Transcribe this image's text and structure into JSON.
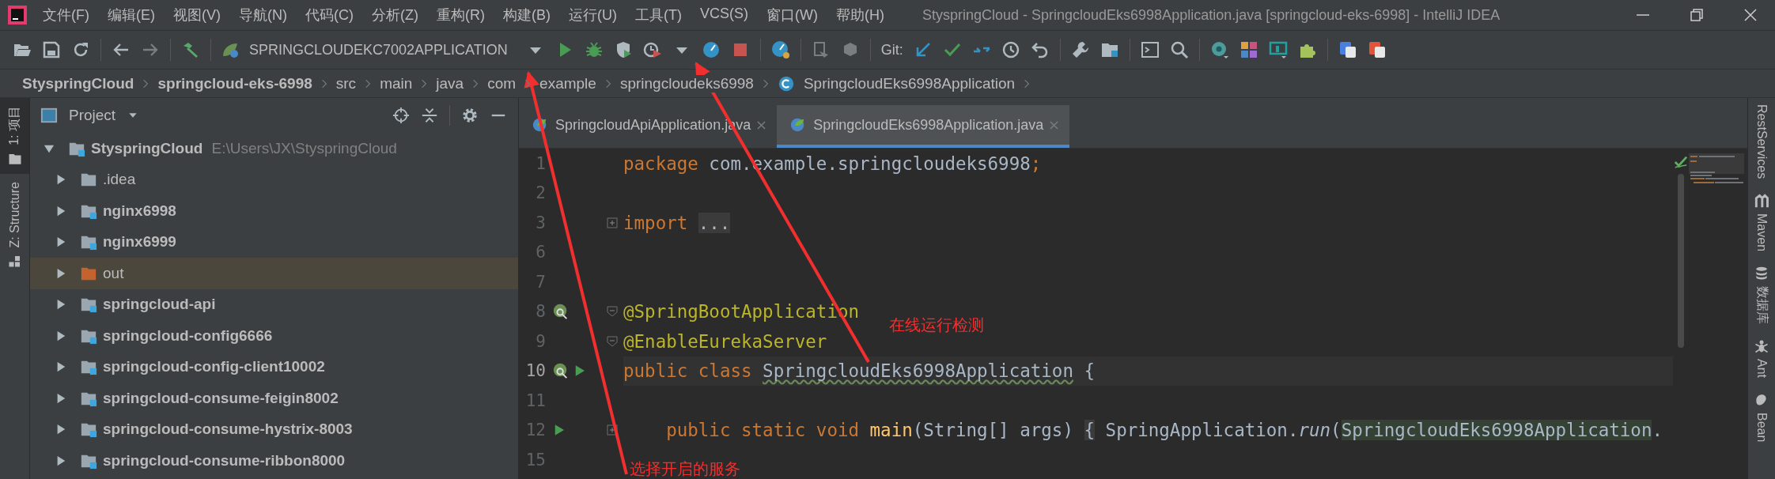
{
  "window": {
    "title": "StyspringCloud - SpringcloudEks6998Application.java [springcloud-eks-6998] - IntelliJ IDEA"
  },
  "menu": [
    "文件(F)",
    "编辑(E)",
    "视图(V)",
    "导航(N)",
    "代码(C)",
    "分析(Z)",
    "重构(R)",
    "构建(B)",
    "运行(U)",
    "工具(T)",
    "VCS(S)",
    "窗口(W)",
    "帮助(H)"
  ],
  "toolbar": {
    "run_configuration": "SPRINGCLOUDEKC7002APPLICATION",
    "git_label": "Git:"
  },
  "breadcrumbs": [
    {
      "label": "StyspringCloud",
      "kind": "project"
    },
    {
      "label": "springcloud-eks-6998",
      "kind": "module"
    },
    {
      "label": "src",
      "kind": "folder"
    },
    {
      "label": "main",
      "kind": "folder"
    },
    {
      "label": "java",
      "kind": "folder"
    },
    {
      "label": "com",
      "kind": "folder"
    },
    {
      "label": "example",
      "kind": "folder"
    },
    {
      "label": "springcloudeks6998",
      "kind": "folder"
    },
    {
      "label": "SpringcloudEks6998Application",
      "kind": "class"
    }
  ],
  "left_tool_windows": [
    {
      "label": "1: 项目",
      "kind": "project",
      "selected": true
    },
    {
      "label": "Z: Structure",
      "kind": "structure",
      "selected": false
    }
  ],
  "project_panel": {
    "title": "Project",
    "tree": {
      "label": "StyspringCloud",
      "path": "E:\\Users\\JX\\StyspringCloud",
      "expanded": true,
      "selected": false,
      "children": [
        {
          "label": ".idea",
          "kind": "folder",
          "expanded": false,
          "selected": false
        },
        {
          "label": "nginx6998",
          "kind": "module",
          "expanded": false,
          "selected": false
        },
        {
          "label": "nginx6999",
          "kind": "module",
          "expanded": false,
          "selected": false
        },
        {
          "label": "out",
          "kind": "excluded",
          "expanded": false,
          "selected": true
        },
        {
          "label": "springcloud-api",
          "kind": "module",
          "expanded": false,
          "selected": false
        },
        {
          "label": "springcloud-config6666",
          "kind": "module",
          "expanded": false,
          "selected": false
        },
        {
          "label": "springcloud-config-client10002",
          "kind": "module",
          "expanded": false,
          "selected": false
        },
        {
          "label": "springcloud-consume-feigin8002",
          "kind": "module",
          "expanded": false,
          "selected": false
        },
        {
          "label": "springcloud-consume-hystrix-8003",
          "kind": "module",
          "expanded": false,
          "selected": false
        },
        {
          "label": "springcloud-consume-ribbon8000",
          "kind": "module",
          "expanded": false,
          "selected": false
        }
      ]
    }
  },
  "editor": {
    "tabs": [
      {
        "label": "SpringcloudApiApplication.java",
        "selected": false
      },
      {
        "label": "SpringcloudEks6998Application.java",
        "selected": true
      }
    ],
    "lines": [
      {
        "number": "1",
        "current": false,
        "tokens": [
          {
            "text": "package",
            "kind": "keyword"
          },
          {
            "text": " com.example.springcloudeks6998",
            "kind": "plain"
          },
          {
            "text": ";",
            "kind": "keyword"
          }
        ]
      },
      {
        "number": "2",
        "current": false
      },
      {
        "number": "3",
        "current": false,
        "gutter": [
          {
            "kind": "fold-collapsed"
          }
        ],
        "tokens": [
          {
            "text": "import",
            "kind": "keyword"
          },
          {
            "text": "...",
            "kind": "folded-after"
          }
        ]
      },
      {
        "number": "6",
        "current": false
      },
      {
        "number": "7",
        "current": false
      },
      {
        "number": "8",
        "current": false,
        "gutter": [
          {
            "kind": "bean"
          },
          {
            "kind": "fold-open"
          }
        ],
        "tokens": [
          {
            "text": "@SpringBootApplication",
            "kind": "annotation"
          }
        ]
      },
      {
        "number": "9",
        "current": false,
        "gutter": [
          {
            "kind": "fold-open"
          }
        ],
        "tokens": [
          {
            "text": "@EnableEurekaServer",
            "kind": "annotation"
          }
        ]
      },
      {
        "number": "10",
        "current": true,
        "gutter": [
          {
            "kind": "bean"
          },
          {
            "kind": "run"
          }
        ],
        "tokens": [
          {
            "text": "public class ",
            "kind": "keyword"
          },
          {
            "text": "SpringcloudEks6998Application",
            "kind": "class"
          },
          {
            "text": " {",
            "kind": "plain"
          }
        ]
      },
      {
        "number": "11",
        "current": false
      },
      {
        "number": "12",
        "current": false,
        "gutter": [
          {
            "kind": "run"
          },
          {
            "kind": "fold-collapsed"
          }
        ],
        "tokens": [
          {
            "text": "    public static void ",
            "kind": "keyword"
          },
          {
            "text": "main",
            "kind": "method"
          },
          {
            "text": "(String[] args) ",
            "kind": "plain"
          },
          {
            "text": "{",
            "kind": "folded"
          },
          {
            "text": " SpringApplication.",
            "kind": "plain"
          },
          {
            "text": "run",
            "kind": "static-call"
          },
          {
            "text": "(",
            "kind": "plain"
          },
          {
            "text": "SpringcloudEks6998Application",
            "kind": "highlight"
          },
          {
            "text": ".",
            "kind": "plain"
          }
        ]
      },
      {
        "number": "15",
        "current": false
      }
    ]
  },
  "right_tool_windows": [
    {
      "label": "RestServices",
      "kind": "plain"
    },
    {
      "label": "Maven",
      "kind": "maven"
    },
    {
      "label": "数据库",
      "kind": "database"
    },
    {
      "label": "Ant",
      "kind": "ant"
    },
    {
      "label": "Bean",
      "kind": "beans"
    }
  ],
  "annotations": [
    {
      "text": "在线运行检测",
      "kind": "note"
    },
    {
      "text": "选择开启的服务",
      "kind": "note"
    }
  ]
}
